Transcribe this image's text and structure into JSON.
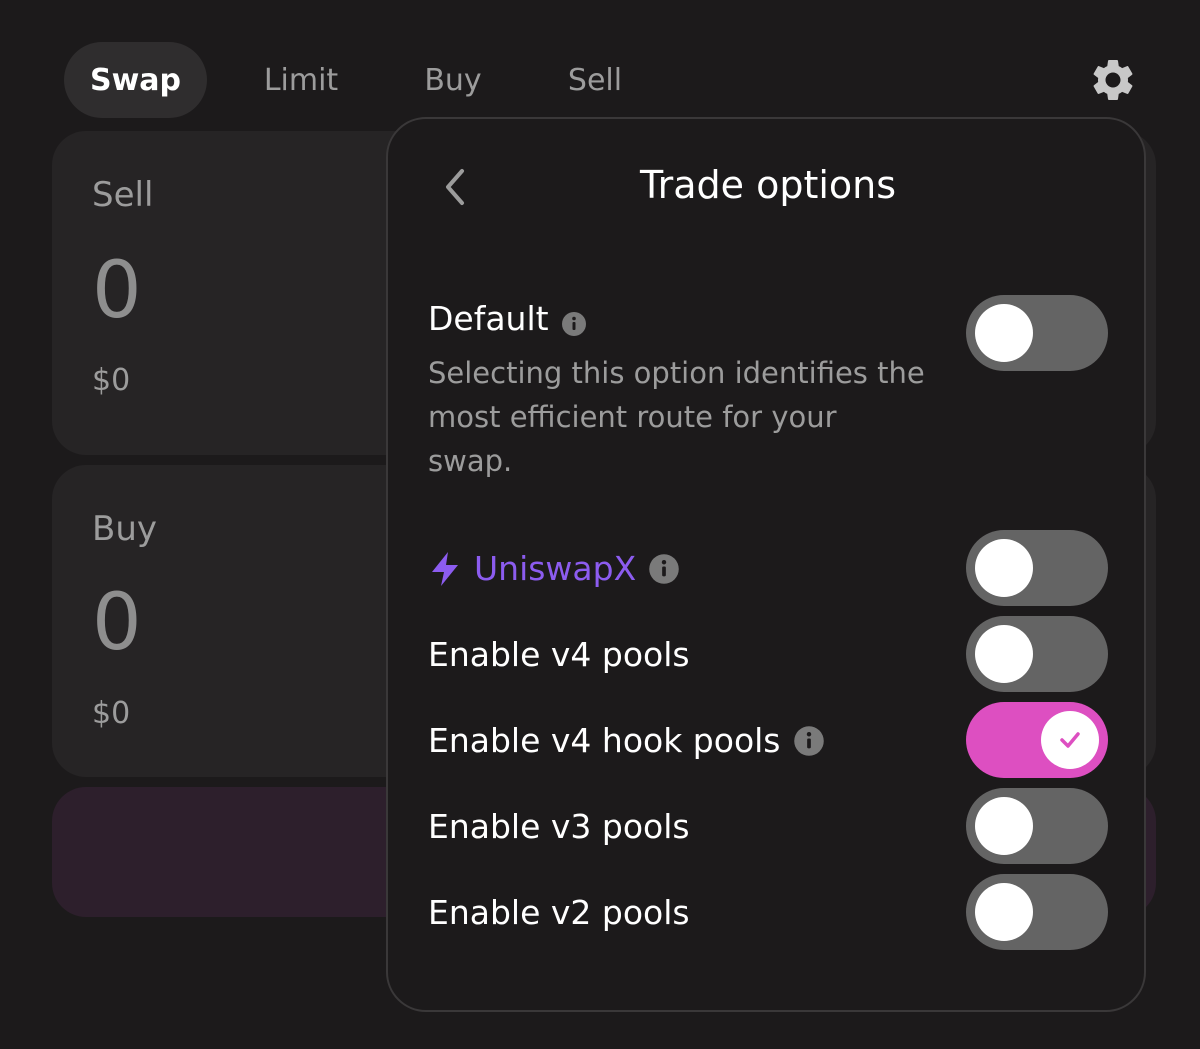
{
  "tabs": {
    "swap": "Swap",
    "limit": "Limit",
    "buy": "Buy",
    "sell": "Sell",
    "active": "Swap"
  },
  "settings_icon": "gear-icon",
  "sell_panel": {
    "label": "Sell",
    "amount": "0",
    "usd": "$0"
  },
  "buy_panel": {
    "label": "Buy",
    "amount": "0",
    "usd": "$0"
  },
  "trade_options": {
    "title": "Trade options",
    "back_icon": "chevron-left-icon",
    "default": {
      "label": "Default",
      "description": "Selecting this option identifies the most efficient route for your swap.",
      "enabled": false
    },
    "uniswapx": {
      "label": "UniswapX",
      "icon": "lightning-icon",
      "enabled": false
    },
    "v4_pools": {
      "label": "Enable v4 pools",
      "enabled": false
    },
    "v4_hook_pools": {
      "label": "Enable v4 hook pools",
      "enabled": true
    },
    "v3_pools": {
      "label": "Enable v3 pools",
      "enabled": false
    },
    "v2_pools": {
      "label": "Enable v2 pools",
      "enabled": false
    }
  },
  "colors": {
    "background": "#1c1a1b",
    "panel": "#262425",
    "accent_purple": "#8c5cf0",
    "toggle_on": "#dd4fc1",
    "toggle_off": "#646464"
  }
}
